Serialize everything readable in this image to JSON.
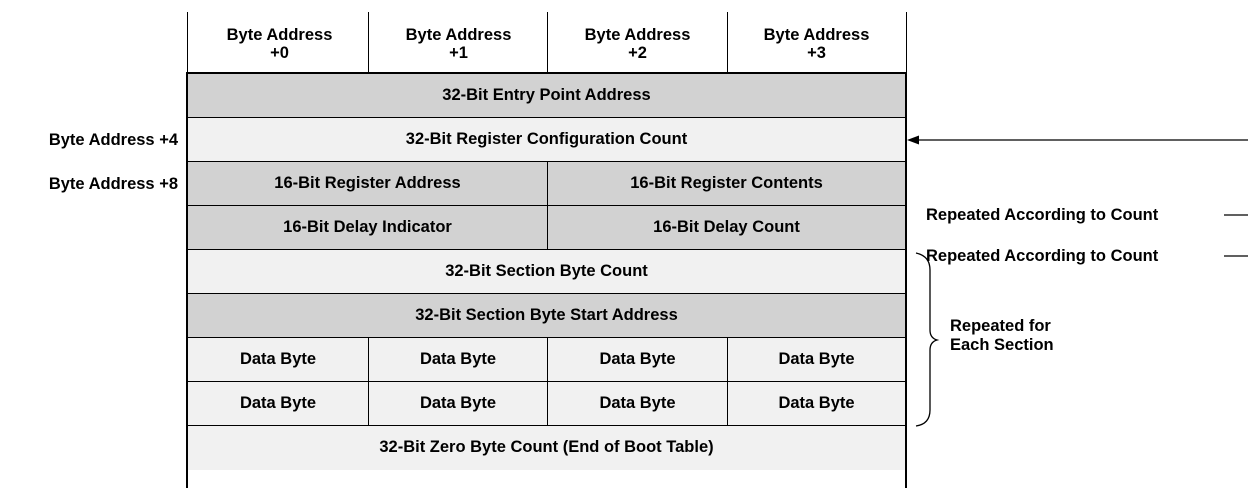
{
  "header": {
    "columns": [
      {
        "line1": "Byte Address",
        "line2": "+0"
      },
      {
        "line1": "Byte Address",
        "line2": "+1"
      },
      {
        "line1": "Byte Address",
        "line2": "+2"
      },
      {
        "line1": "Byte Address",
        "line2": "+3"
      }
    ]
  },
  "rows": {
    "entry_point": "32-Bit Entry Point Address",
    "reg_config_count": "32-Bit Register Configuration Count",
    "reg_address": "16-Bit Register Address",
    "reg_contents": "16-Bit Register Contents",
    "delay_indicator": "16-Bit Delay Indicator",
    "delay_count": "16-Bit Delay Count",
    "section_byte_count": "32-Bit Section Byte Count",
    "section_start_address": "32-Bit Section Byte Start Address",
    "data_byte": "Data Byte",
    "zero_byte_count": "32-Bit Zero Byte Count (End of Boot Table)"
  },
  "left_labels": {
    "plus4": "Byte Address +4",
    "plus8": "Byte Address +8"
  },
  "right_labels": {
    "repeated_count_1": "Repeated According to Count",
    "repeated_count_2": "Repeated According to Count",
    "repeated_section_line1": "Repeated for",
    "repeated_section_line2": "Each Section"
  }
}
